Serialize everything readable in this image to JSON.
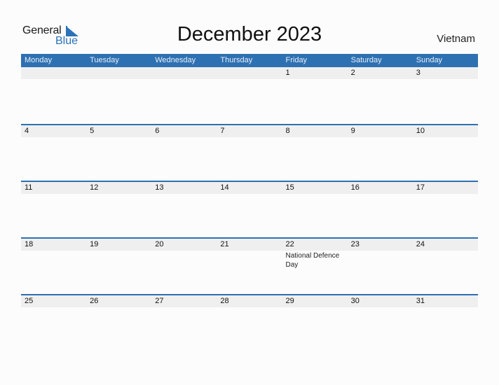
{
  "logo": {
    "line1": "General",
    "line2": "Blue"
  },
  "title": "December 2023",
  "country": "Vietnam",
  "colors": {
    "accent": "#2e71b2",
    "date_strip": "#efefef"
  },
  "weekdays": [
    "Monday",
    "Tuesday",
    "Wednesday",
    "Thursday",
    "Friday",
    "Saturday",
    "Sunday"
  ],
  "weeks": [
    {
      "days": [
        "",
        "",
        "",
        "",
        "1",
        "2",
        "3"
      ],
      "events": [
        "",
        "",
        "",
        "",
        "",
        "",
        ""
      ]
    },
    {
      "days": [
        "4",
        "5",
        "6",
        "7",
        "8",
        "9",
        "10"
      ],
      "events": [
        "",
        "",
        "",
        "",
        "",
        "",
        ""
      ]
    },
    {
      "days": [
        "11",
        "12",
        "13",
        "14",
        "15",
        "16",
        "17"
      ],
      "events": [
        "",
        "",
        "",
        "",
        "",
        "",
        ""
      ]
    },
    {
      "days": [
        "18",
        "19",
        "20",
        "21",
        "22",
        "23",
        "24"
      ],
      "events": [
        "",
        "",
        "",
        "",
        "National Defence Day",
        "",
        ""
      ]
    },
    {
      "days": [
        "25",
        "26",
        "27",
        "28",
        "29",
        "30",
        "31"
      ],
      "events": [
        "",
        "",
        "",
        "",
        "",
        "",
        ""
      ]
    }
  ]
}
